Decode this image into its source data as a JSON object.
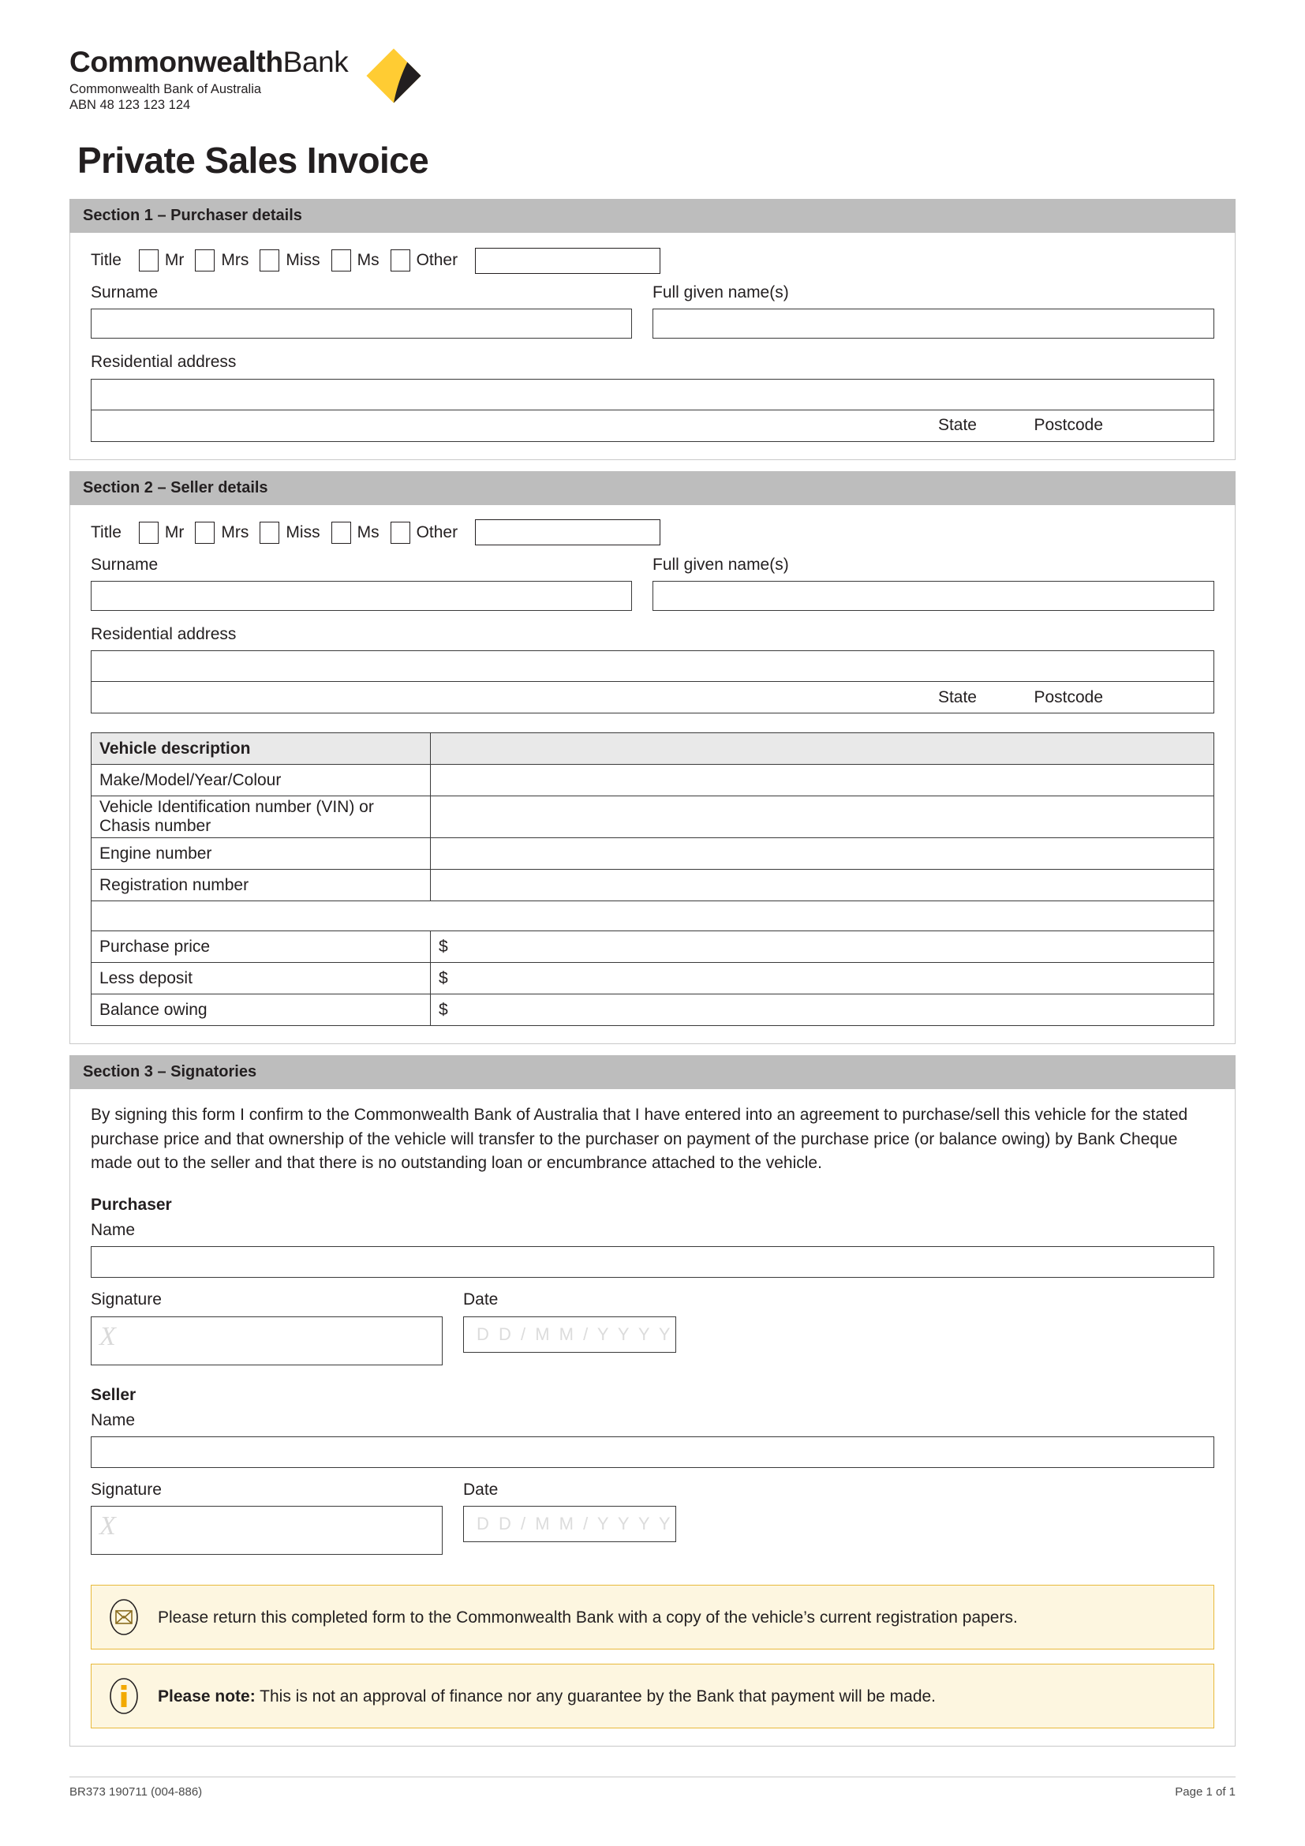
{
  "brand": {
    "logo_bold": "Commonwealth",
    "logo_light": "Bank",
    "legal_name": "Commonwealth Bank of Australia",
    "abn": "ABN 48 123 123 124",
    "accent_yellow": "#FFCC33",
    "accent_dark": "#231F20"
  },
  "document": {
    "title": "Private Sales Invoice"
  },
  "title_options": {
    "label": "Title",
    "options": [
      "Mr",
      "Mrs",
      "Miss",
      "Ms",
      "Other"
    ]
  },
  "field_labels": {
    "surname": "Surname",
    "full_given_names": "Full given name(s)",
    "residential_address": "Residential address",
    "state": "State",
    "postcode": "Postcode"
  },
  "section1": {
    "heading": "Section 1 – Purchaser details"
  },
  "section2": {
    "heading": "Section 2 – Seller details",
    "vehicle_table": {
      "header_label": "Vehicle description",
      "header_value": "",
      "rows": [
        {
          "label": "Make/Model/Year/Colour",
          "value": ""
        },
        {
          "label": "Vehicle Identification number (VIN) or Chasis number",
          "value": ""
        },
        {
          "label": "Engine number",
          "value": ""
        },
        {
          "label": "Registration number",
          "value": ""
        }
      ],
      "price_rows": [
        {
          "label": "Purchase price",
          "value": "$"
        },
        {
          "label": "Less deposit",
          "value": "$"
        },
        {
          "label": "Balance owing",
          "value": "$"
        }
      ]
    }
  },
  "section3": {
    "heading": "Section 3 – Signatories",
    "declaration": "By signing this form I confirm to the Commonwealth Bank of Australia that I have entered into an agreement to purchase/sell this vehicle for the stated purchase price and that ownership of the vehicle will transfer to the purchaser on payment of the purchase price (or balance owing) by Bank Cheque made out to the seller and that there is no outstanding loan or encumbrance attached to the vehicle.",
    "purchaser": {
      "party_label": "Purchaser",
      "name_label": "Name",
      "name_value": "",
      "signature_label": "Signature",
      "signature_placeholder": "X",
      "date_label": "Date",
      "date_placeholder": "D D / M M / Y Y Y Y"
    },
    "seller": {
      "party_label": "Seller",
      "name_label": "Name",
      "name_value": "",
      "signature_label": "Signature",
      "signature_placeholder": "X",
      "date_label": "Date",
      "date_placeholder": "D D / M M / Y Y Y Y"
    }
  },
  "notices": [
    {
      "icon": "envelope-icon",
      "bold_prefix": "",
      "text": "Please return this completed form to the Commonwealth Bank with a copy of the vehicle’s current registration papers."
    },
    {
      "icon": "info-icon",
      "bold_prefix": "Please note:",
      "text": " This is not an approval of finance nor any guarantee by the Bank that payment will be made."
    }
  ],
  "footer": {
    "form_code": "BR373 190711  (004-886)",
    "page_label": "Page 1 of 1"
  }
}
